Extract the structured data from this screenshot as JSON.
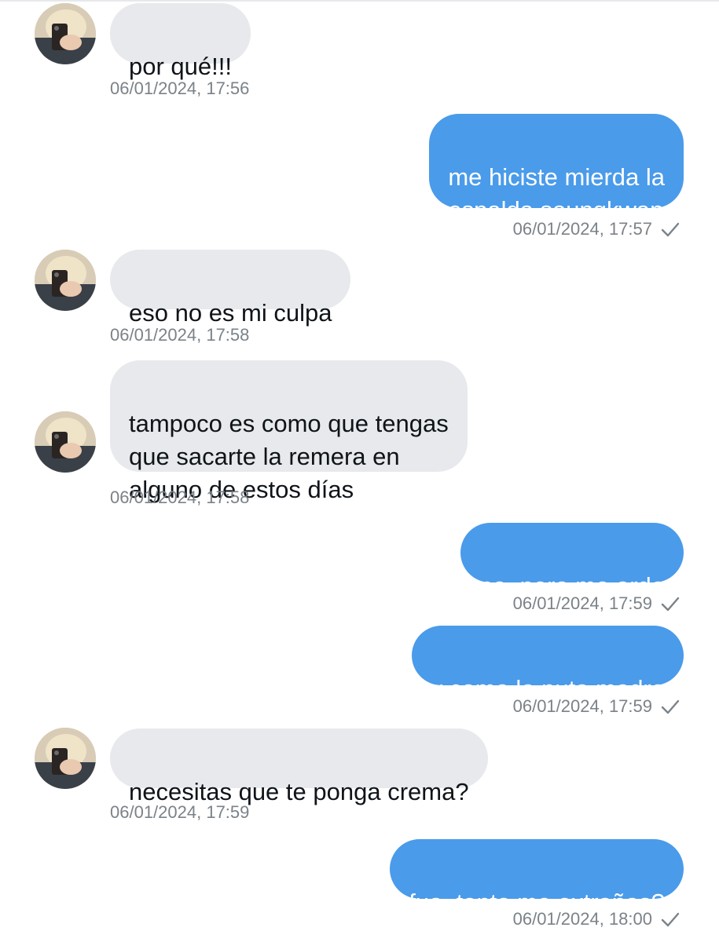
{
  "conversation": {
    "messages": [
      {
        "direction": "in",
        "text": "por qué!!!",
        "timestamp": "06/01/2024, 17:56"
      },
      {
        "direction": "out",
        "text": "me hiciste mierda la\nespalda seungkwan",
        "timestamp": "06/01/2024, 17:57"
      },
      {
        "direction": "in",
        "text": "eso no es mi culpa",
        "timestamp": "06/01/2024, 17:58"
      },
      {
        "direction": "in",
        "text": "tampoco es como que tengas\nque sacarte la remera en\nalguno de estos días",
        "timestamp": "06/01/2024, 17:58"
      },
      {
        "direction": "out",
        "text": "no, pero me arde",
        "timestamp": "06/01/2024, 17:59"
      },
      {
        "direction": "out",
        "text": "y como la puta madre",
        "timestamp": "06/01/2024, 17:59"
      },
      {
        "direction": "in",
        "text": "necesitas que te ponga crema?",
        "timestamp": "06/01/2024, 17:59"
      },
      {
        "direction": "out",
        "text": "fua, tanto me extrañas?",
        "timestamp": "06/01/2024, 18:00"
      }
    ]
  },
  "icons": {
    "read_receipt": "checkmark-icon",
    "avatar": "avatar"
  },
  "colors": {
    "incoming_bubble": "#e7e9ec",
    "outgoing_bubble": "#4a9bea",
    "timestamp_text": "#7b8288"
  }
}
